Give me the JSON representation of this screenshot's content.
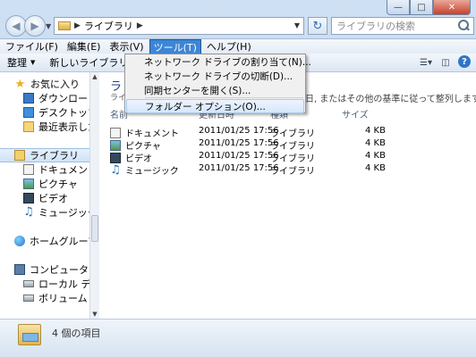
{
  "address": {
    "text": "ライブラリ"
  },
  "search": {
    "placeholder": "ライブラリの検索"
  },
  "menu": [
    "ファイル(F)",
    "編集(E)",
    "表示(V)",
    "ツール(T)",
    "ヘルプ(H)"
  ],
  "toolbar": {
    "organize": "整理",
    "new_library": "新しいライブラリ"
  },
  "dropdown": {
    "items": [
      "ネットワーク ドライブの割り当て(N)...",
      "ネットワーク ドライブの切断(D)...",
      "同期センターを開く(S)...",
      "フォルダー オプション(O)..."
    ]
  },
  "nav": {
    "favorites": "お気に入り",
    "downloads": "ダウンロード",
    "desktop": "デスクトップ",
    "recent": "最近表示した場",
    "libraries": "ライブラリ",
    "documents": "ドキュメント",
    "pictures": "ピクチャ",
    "videos": "ビデオ",
    "music": "ミュージック",
    "homegroup": "ホームグループ",
    "computer": "コンピューター",
    "local_disk": "ローカル ディス",
    "volume": "ボリューム (E:)"
  },
  "content": {
    "title": "ラ",
    "subtitle": "ライ",
    "subtitle_right": "日, またはその他の基準に従って整列します。",
    "columns": {
      "name": "名前",
      "date": "更新日時",
      "type": "種類",
      "size": "サイズ"
    },
    "rows": [
      {
        "name": "ドキュメント",
        "date": "2011/01/25 17:56",
        "type": "ライブラリ",
        "size": "4 KB",
        "icon": "document-library-icon"
      },
      {
        "name": "ピクチャ",
        "date": "2011/01/25 17:56",
        "type": "ライブラリ",
        "size": "4 KB",
        "icon": "picture-library-icon"
      },
      {
        "name": "ビデオ",
        "date": "2011/01/25 17:56",
        "type": "ライブラリ",
        "size": "4 KB",
        "icon": "video-library-icon"
      },
      {
        "name": "ミュージック",
        "date": "2011/01/25 17:56",
        "type": "ライブラリ",
        "size": "4 KB",
        "icon": "music-library-icon"
      }
    ]
  },
  "details": {
    "count": "4 個の項目"
  }
}
